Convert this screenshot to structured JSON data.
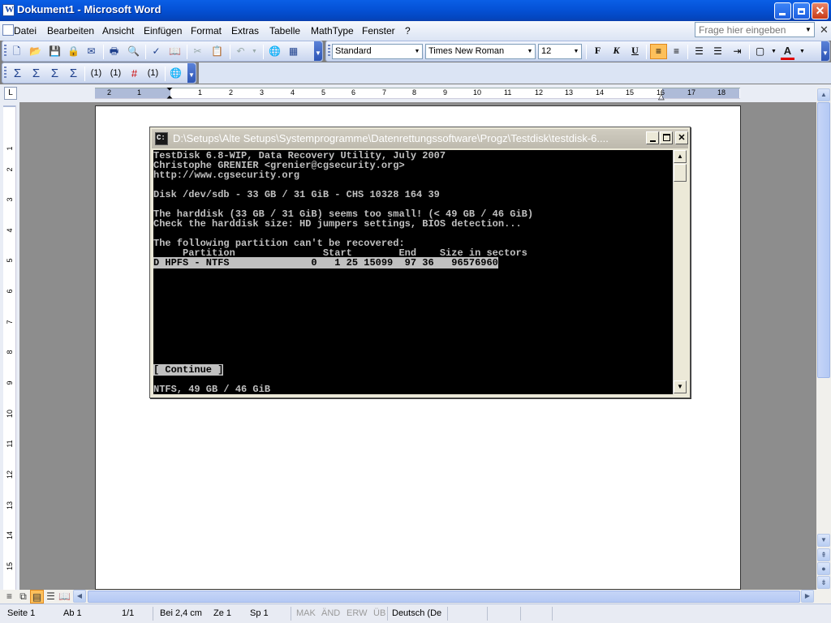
{
  "window": {
    "title": "Dokument1 - Microsoft Word"
  },
  "menu": {
    "items": [
      "Datei",
      "Bearbeiten",
      "Ansicht",
      "Einfügen",
      "Format",
      "Extras",
      "Tabelle",
      "MathType",
      "Fenster",
      "?"
    ],
    "help_placeholder": "Frage hier eingeben"
  },
  "format_toolbar": {
    "style": "Standard",
    "font": "Times New Roman",
    "size": "12",
    "bold": "F",
    "italic": "K",
    "underline": "U",
    "font_color": "A"
  },
  "mathtype_toolbar": {
    "n1": "(1)",
    "n2": "(1)",
    "n3": "(1)"
  },
  "ruler": {
    "h_marks": [
      "2",
      "1",
      "1",
      "2",
      "3",
      "4",
      "5",
      "6",
      "7",
      "8",
      "9",
      "10",
      "11",
      "12",
      "13",
      "14",
      "15",
      "16",
      "17",
      "18"
    ],
    "v_marks": [
      "1",
      "1",
      "2",
      "3",
      "4",
      "5",
      "6",
      "7",
      "8",
      "9",
      "10",
      "11",
      "12",
      "13",
      "14",
      "15"
    ]
  },
  "console": {
    "title": "D:\\Setups\\Alte Setups\\Systemprogramme\\Datenrettungssoftware\\Progz\\Testdisk\\testdisk-6....",
    "lines": [
      "TestDisk 6.8-WIP, Data Recovery Utility, July 2007",
      "Christophe GRENIER <grenier@cgsecurity.org>",
      "http://www.cgsecurity.org",
      "",
      "Disk /dev/sdb - 33 GB / 31 GiB - CHS 10328 164 39",
      "",
      "The harddisk (33 GB / 31 GiB) seems too small! (< 49 GB / 46 GiB)",
      "Check the harddisk size: HD jumpers settings, BIOS detection...",
      "",
      "The following partition can't be recovered:",
      "     Partition               Start        End    Size in sectors"
    ],
    "partition_row": "D HPFS - NTFS              0   1 25 15099  97 36   96576960",
    "continue_label": "[ Continue ]",
    "footer": "NTFS, 49 GB / 46 GiB"
  },
  "status": {
    "seite": "Seite 1",
    "ab": "Ab 1",
    "pages": "1/1",
    "bei": "Bei 2,4 cm",
    "ze": "Ze 1",
    "sp": "Sp 1",
    "mak": "MAK",
    "aend": "ÄND",
    "erw": "ERW",
    "ueb": "ÜB",
    "lang": "Deutsch (De"
  }
}
